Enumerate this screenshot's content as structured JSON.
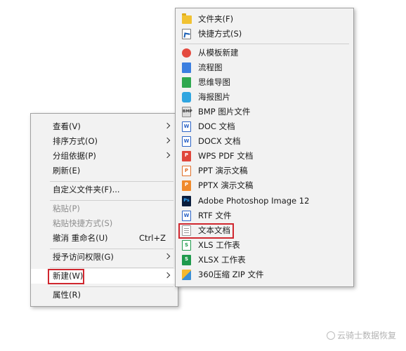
{
  "context_menu": {
    "items": [
      {
        "label": "查看(V)",
        "submenu": true
      },
      {
        "label": "排序方式(O)",
        "submenu": true
      },
      {
        "label": "分组依据(P)",
        "submenu": true
      },
      {
        "label": "刷新(E)"
      },
      {
        "label": "自定义文件夹(F)..."
      },
      {
        "label": "粘贴(P)",
        "disabled": true
      },
      {
        "label": "粘贴快捷方式(S)",
        "disabled": true
      },
      {
        "label": "撤消 重命名(U)",
        "accelerator": "Ctrl+Z"
      },
      {
        "label": "授予访问权限(G)",
        "submenu": true
      },
      {
        "label": "新建(W)",
        "submenu": true,
        "highlighted": true
      },
      {
        "label": "属性(R)"
      }
    ]
  },
  "new_submenu": {
    "items": [
      {
        "label": "文件夹(F)",
        "icon": "folder-icon"
      },
      {
        "label": "快捷方式(S)",
        "icon": "shortcut-icon"
      },
      {
        "label": "从模板新建",
        "icon": "template-icon"
      },
      {
        "label": "流程图",
        "icon": "flowchart-icon"
      },
      {
        "label": "思维导图",
        "icon": "mindmap-icon"
      },
      {
        "label": "海报图片",
        "icon": "poster-icon"
      },
      {
        "label": "BMP 图片文件",
        "icon": "bmp-file-icon",
        "glyph": "BMP"
      },
      {
        "label": "DOC 文档",
        "icon": "doc-file-icon",
        "glyph": "W"
      },
      {
        "label": "DOCX 文档",
        "icon": "docx-file-icon",
        "glyph": "W"
      },
      {
        "label": "WPS PDF 文档",
        "icon": "pdf-file-icon",
        "glyph": "P"
      },
      {
        "label": "PPT 演示文稿",
        "icon": "ppt-file-icon",
        "glyph": "P"
      },
      {
        "label": "PPTX 演示文稿",
        "icon": "pptx-file-icon",
        "glyph": "P"
      },
      {
        "label": "Adobe Photoshop Image 12",
        "icon": "photoshop-file-icon",
        "glyph": "Ps"
      },
      {
        "label": "RTF 文件",
        "icon": "rtf-file-icon",
        "glyph": "W"
      },
      {
        "label": "文本文档",
        "icon": "text-file-icon",
        "highlighted": true
      },
      {
        "label": "XLS 工作表",
        "icon": "xls-file-icon",
        "glyph": "S"
      },
      {
        "label": "XLSX 工作表",
        "icon": "xlsx-file-icon",
        "glyph": "S"
      },
      {
        "label": "360压缩 ZIP 文件",
        "icon": "zip-file-icon"
      }
    ]
  },
  "watermark": "云骑士数据恢复",
  "colors": {
    "highlight_box": "#d0272f",
    "menu_bg": "#f2f2f2"
  }
}
